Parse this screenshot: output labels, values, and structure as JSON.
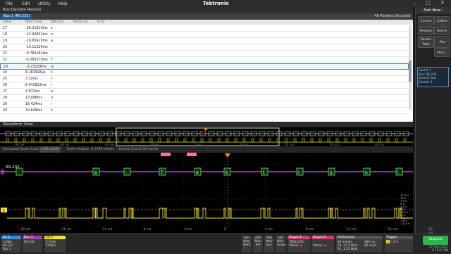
{
  "menu": {
    "items": [
      "File",
      "Edit",
      "Utility",
      "Help"
    ],
    "brand": "Tektronix",
    "window_controls": "– ▢ ✕"
  },
  "right_panel": {
    "add_new": "Add New...",
    "buttons": [
      "Cursors",
      "Callout",
      "Measure",
      "Search",
      "Results Table",
      "Plot",
      "More..."
    ],
    "search": {
      "title": "Search 1",
      "line1": "Bus: RS-232",
      "line2": "Search: Bus",
      "line3": "Events: 1"
    }
  },
  "results": {
    "title": "Bus Decode Results",
    "bus_tab": "Bus 1 (RS-232)",
    "packets": "48 Packets Decoded",
    "columns": [
      "Index",
      "Start Time",
      "Data (a)",
      "Parity (a)",
      "Error"
    ],
    "rows": [
      {
        "index": "17",
        "time": "-26.21819ms",
        "data": "s"
      },
      {
        "index": "18",
        "time": "-22.93852ms",
        "data": "n"
      },
      {
        "index": "19",
        "time": "-19.65419ms",
        "data": "a"
      },
      {
        "index": "20",
        "time": "-13.11226ms",
        "data": "-"
      },
      {
        "index": "21",
        "time": "-9.784182ms",
        "data": "-"
      },
      {
        "index": "22",
        "time": "-6.560178ms",
        "data": "T"
      },
      {
        "index": "23",
        "time": "-3.23219ms",
        "data": "e"
      },
      {
        "index": "24",
        "time": "8.181818µs",
        "data": "k"
      },
      {
        "index": "25",
        "time": "3.32ms",
        "data": "t"
      },
      {
        "index": "26",
        "time": "6.543822ms",
        "data": "r"
      },
      {
        "index": "27",
        "time": "9.872ms",
        "data": "o"
      },
      {
        "index": "28",
        "time": "13.096ms",
        "data": "n"
      },
      {
        "index": "29",
        "time": "16.424ms",
        "data": "i"
      },
      {
        "index": "30",
        "time": "19.648ms",
        "data": "x"
      }
    ],
    "selected_index": "23"
  },
  "waveform": {
    "title": "Waveform View",
    "zoom_labels": [
      "Horizontal Zoom Scale",
      "4.00 ms/div",
      "Zoom Position",
      "-2.7795 ms/div",
      "Vertical Zoom",
      "2.00 ms/div"
    ],
    "overview_ticks": [
      "-40 ms",
      "-30 ms",
      "-20 ms",
      "-10 ms",
      "0 ms",
      "10 ms",
      "20 ms",
      "30 ms",
      "40 ms"
    ],
    "bus_label": "RS-232",
    "decoded_chars": [
      "a",
      "-",
      "T",
      "e",
      "k",
      "t",
      "r",
      "o",
      "n",
      "i"
    ],
    "time_ticks": [
      "-20 ms",
      "-16 ms",
      "-12 ms",
      "-8 ms",
      "-4 ms",
      "0",
      "4 ms",
      "8 ms",
      "12 ms",
      "16 ms",
      "20 ms"
    ],
    "volt_ticks": [
      "12.5 V",
      "10 V",
      "7.5 V",
      "5 V",
      "2.5 V",
      "0 V",
      "-2.5 V",
      "-5 V",
      "-7.5 V",
      "-10 V",
      "-12.5 V"
    ],
    "ch_label": "1"
  },
  "bottom": {
    "ch1": {
      "title": "Ch 1",
      "line1": "1.0kΩ",
      "line2": "RS-232",
      "line3": "Bus 1"
    },
    "bus1": {
      "title": "Bus 1",
      "line1": "RS-232",
      "line2": "",
      "line3": ""
    },
    "ch1b": {
      "title": "Ch 1",
      "line1": "5 V/div",
      "line2": "500kΩ",
      "line3": ""
    },
    "add_buttons": [
      "Add New Math",
      "Add New Ref",
      "Add New Bus",
      "Add New Scope"
    ],
    "scope1": {
      "title": "Scope 1",
      "line1": "TBS1202C",
      "line2": "Status:"
    },
    "scope2": {
      "title": "Scope 2",
      "line1": "",
      "line2": "Status:"
    },
    "horizontal": {
      "title": "Horizontal",
      "line1": "10 ms/div",
      "line2": "SR: 12.5 MS/s",
      "line3": "RL: 1.25 Mpts",
      "line4": "100 ms",
      "line5": "80 ns/pt"
    },
    "trigger": {
      "title": "Trigger",
      "line1": "1",
      "line2": "0 V"
    },
    "acquire": "Acquire",
    "date": "27 May 2022",
    "time": "1:11:02 PM"
  },
  "colors": {
    "selection": "#3a8ad8",
    "bus": "#e54fe0",
    "channel": "#f0e130",
    "acquire": "#2db34a",
    "trigger_marker": "#ff8a00",
    "cursor": "#ff6fb0"
  }
}
